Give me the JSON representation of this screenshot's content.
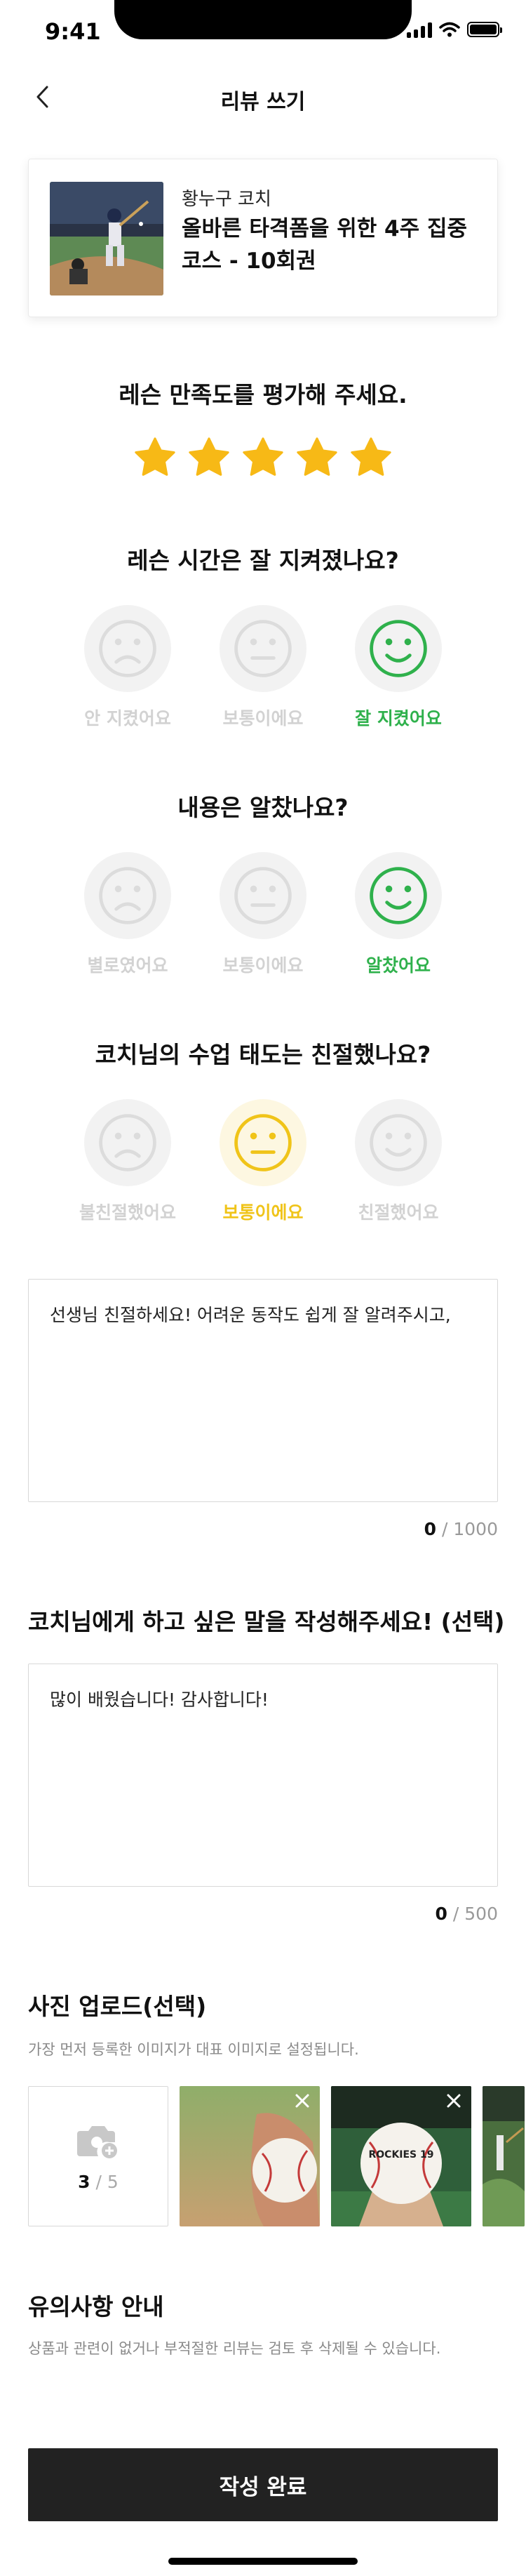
{
  "status_bar": {
    "time": "9:41"
  },
  "header": {
    "title": "리뷰 쓰기"
  },
  "lesson": {
    "coach": "황누구 코치",
    "title": "올바른 타격폼을 위한 4주 집중코스 - 10회권"
  },
  "rating": {
    "question": "레슨 만족도를 평가해 주세요.",
    "stars": 5,
    "max_stars": 5,
    "star_color": "#f7b916"
  },
  "questions": [
    {
      "question": "레슨 시간은 잘 지켜졌나요?",
      "options": [
        "안 지켰어요",
        "보통이에요",
        "잘 지켰어요"
      ],
      "selected": 2
    },
    {
      "question": "내용은 알찼나요?",
      "options": [
        "별로였어요",
        "보통이에요",
        "알찼어요"
      ],
      "selected": 2
    },
    {
      "question": "코치님의 수업 태도는 친절했나요?",
      "options": [
        "불친절했어요",
        "보통이에요",
        "친절했어요"
      ],
      "selected": 1
    }
  ],
  "review": {
    "text": "선생님 친절하세요! 어려운 동작도 쉽게 잘 알려주시고,",
    "count": "0",
    "max": "1000"
  },
  "message": {
    "title": "코치님에게 하고 싶은 말을 작성해주세요! (선택)",
    "text": "많이 배웠습니다! 감사합니다!",
    "count": "0",
    "max": "500"
  },
  "photos": {
    "title": "사진 업로드(선택)",
    "description": "가장 먼저 등록한 이미지가 대표 이미지로 설정됩니다.",
    "count": "3",
    "max": "5",
    "ball_text": "ROCKIES 19"
  },
  "notice": {
    "title": "유의사항 안내",
    "description": "상품과 관련이 없거나 부적절한 리뷰는 검토 후 삭제될 수 있습니다."
  },
  "submit_label": "작성 완료",
  "colors": {
    "green": "#2fb14c",
    "yellow": "#f0c419",
    "inactive": "#d2d2d2",
    "button": "#222222"
  }
}
